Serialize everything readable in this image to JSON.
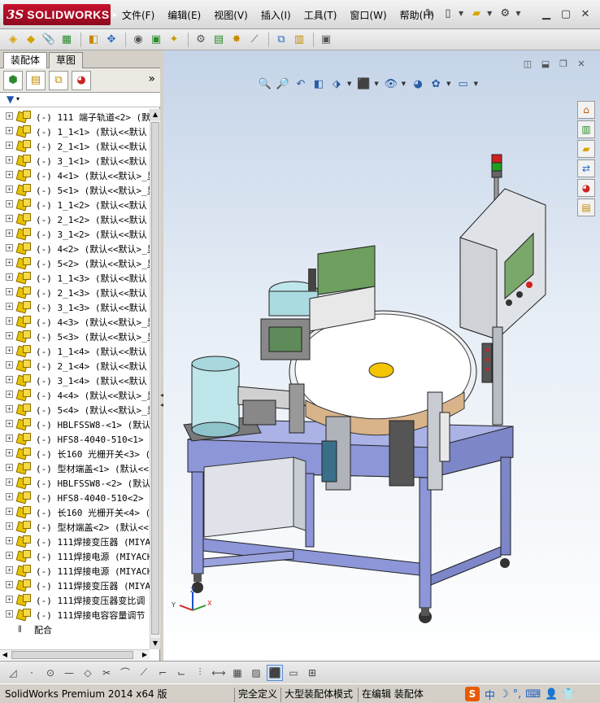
{
  "app": {
    "logo_ds": "3S",
    "logo_text": "SOLIDWORKS"
  },
  "menu": [
    "文件(F)",
    "编辑(E)",
    "视图(V)",
    "插入(I)",
    "工具(T)",
    "窗口(W)",
    "帮助(H)"
  ],
  "panel": {
    "tabs": [
      "装配体",
      "草图"
    ],
    "tree_items": [
      "(-) 111  端子轨道<2> (默",
      "(-) 1_1<1> (默认<<默认",
      "(-) 2_1<1> (默认<<默认",
      "(-) 3_1<1> (默认<<默认",
      "(-) 4<1> (默认<<默认>_显",
      "(-) 5<1> (默认<<默认>_显",
      "(-) 1_1<2> (默认<<默认",
      "(-) 2_1<2> (默认<<默认",
      "(-) 3_1<2> (默认<<默认",
      "(-) 4<2> (默认<<默认>_显",
      "(-) 5<2> (默认<<默认>_显",
      "(-) 1_1<3> (默认<<默认",
      "(-) 2_1<3> (默认<<默认",
      "(-) 3_1<3> (默认<<默认",
      "(-) 4<3> (默认<<默认>_显",
      "(-) 5<3> (默认<<默认>_显",
      "(-) 1_1<4> (默认<<默认",
      "(-) 2_1<4> (默认<<默认",
      "(-) 3_1<4> (默认<<默认",
      "(-) 4<4> (默认<<默认>_显",
      "(-) 5<4> (默认<<默认>_显",
      "(-) HBLFSSW8-<1> (默认<",
      "(-) HFS8-4040-510<1> (默",
      "(-) 长160 光栅开关<3> (",
      "(-) 型材端盖<1> (默认<<",
      "(-) HBLFSSW8-<2> (默认<",
      "(-) HFS8-4040-510<2> (默",
      "(-) 长160 光栅开关<4> (",
      "(-) 型材端盖<2> (默认<<",
      "(-) 111焊接变压器 (MIYA",
      "(-) 111焊接电源 (MIYACH",
      "(-) 111焊接电源 (MIYACH",
      "(-) 111焊接变压器 (MIYA",
      "(-) 111焊接变压器变比调",
      "(-) 111焊接电容容量调节"
    ],
    "mates_label": "配合"
  },
  "status": {
    "version": "SolidWorks Premium 2014 x64 版",
    "definition": "完全定义",
    "mode": "大型装配体模式",
    "editing": "在编辑 装配体"
  },
  "ime": {
    "logo": "S",
    "lang": "中"
  },
  "triad": {
    "x": "X",
    "y": "Y",
    "z": "Z"
  },
  "colors": {
    "brand_red": "#c8102e",
    "frame_blue": "#8c96d8",
    "panel_green": "#7aa86a",
    "lamp_red": "#d02020",
    "lamp_green": "#20a020",
    "center_yellow": "#f4c400"
  }
}
